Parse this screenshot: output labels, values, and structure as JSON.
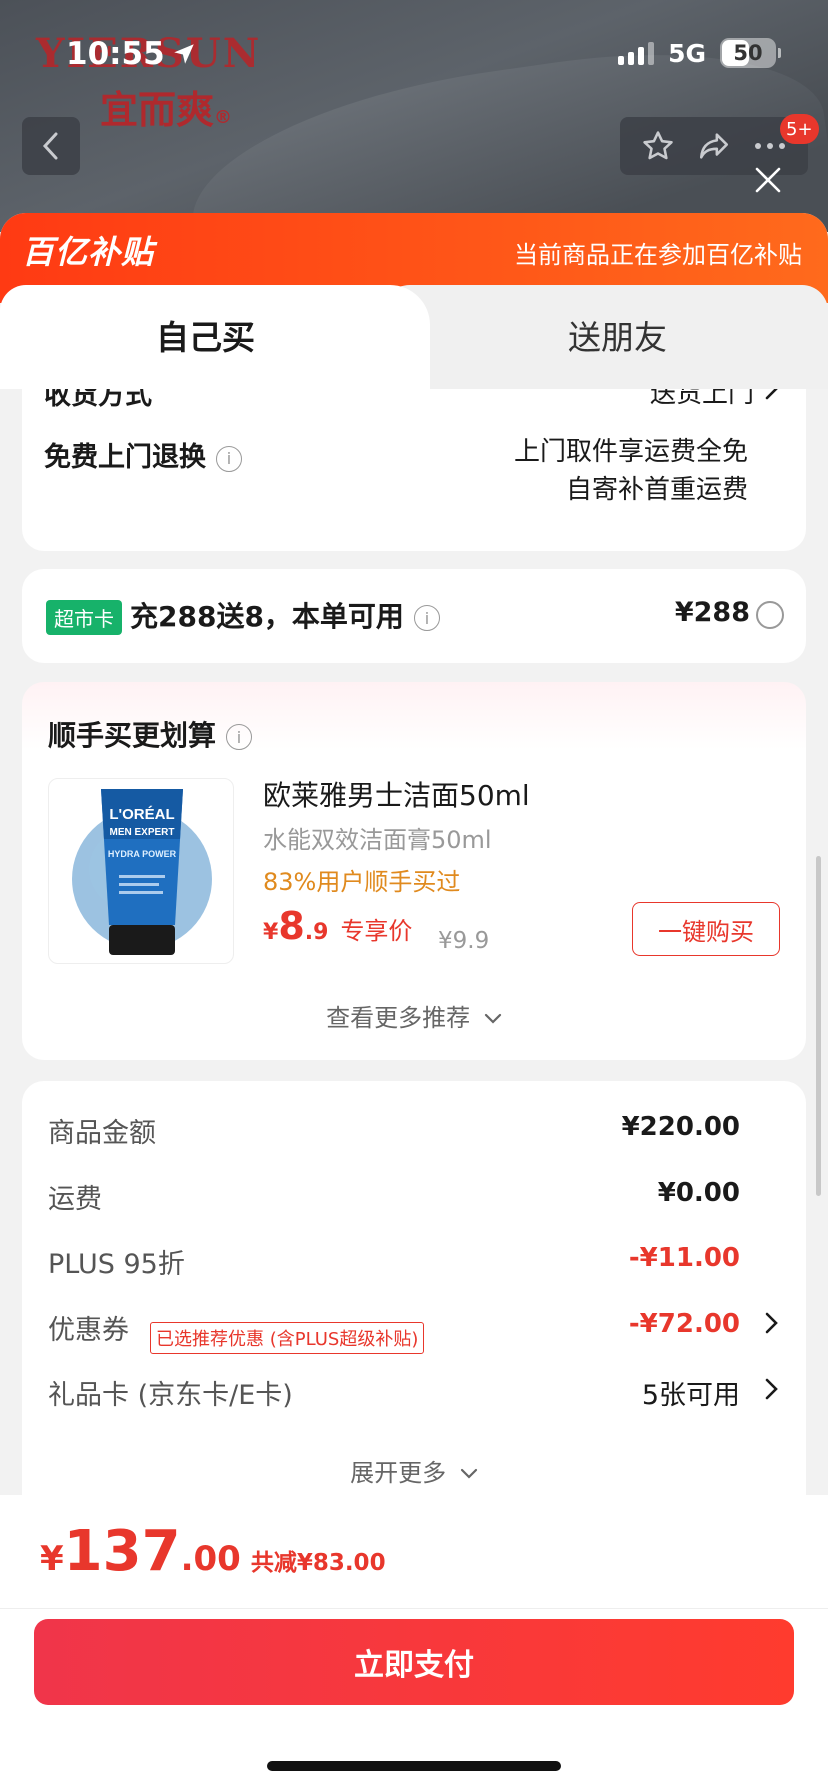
{
  "status_bar": {
    "time": "10:55",
    "network": "5G",
    "battery": "50",
    "battery_level": 0.5
  },
  "brand": {
    "name_latin": "YIERSUN",
    "name_cn": "宜而爽",
    "mark": "®"
  },
  "header": {
    "cart_badge": "5+"
  },
  "subsidy": {
    "logo_text": "百亿补贴",
    "note": "当前商品正在参加百亿补贴"
  },
  "tabs": [
    {
      "label": "自己买",
      "active": true
    },
    {
      "label": "送朋友",
      "active": false
    }
  ],
  "delivery": {
    "method_label": "收货方式",
    "method_value": "送货上门",
    "return_label": "免费上门退换",
    "return_value_line1": "上门取件享运费全免",
    "return_value_line2": "自寄补首重运费"
  },
  "supermarket_card": {
    "tag": "超市卡",
    "text": "充288送8，本单可用",
    "price": "¥288"
  },
  "recommendation": {
    "title": "顺手买更划算",
    "product": {
      "image_brand": "L'ORÉAL",
      "image_line": "MEN EXPERT",
      "image_sub": "HYDRA POWER",
      "name": "欧莱雅男士洁面50ml",
      "subtitle": "水能双效洁面膏50ml",
      "rate": "83%用户顺手买过",
      "price_currency": "¥",
      "price_int": "8",
      "price_dec": ".9",
      "price_label": "专享价",
      "orig_price": "¥9.9",
      "buy_label": "一键购买"
    },
    "more_label": "查看更多推荐"
  },
  "summary": {
    "rows": [
      {
        "label": "商品金额",
        "value": "¥220.00"
      },
      {
        "label": "运费",
        "value": "¥0.00"
      },
      {
        "label": "PLUS 95折",
        "value": "-¥11.00"
      },
      {
        "label": "优惠券",
        "tag": "已选推荐优惠 (含PLUS超级补贴)",
        "value": "-¥72.00"
      },
      {
        "label": "礼品卡 (京东卡/E卡)",
        "value": "5张可用"
      }
    ],
    "expand_label": "展开更多"
  },
  "footer": {
    "currency": "¥",
    "total_int": "137",
    "total_dec": ".00",
    "saved": "共减¥83.00",
    "pay_label": "立即支付"
  },
  "colors": {
    "accent": "#e8372c",
    "subsidy_orange": "#ff4a16",
    "tag_green": "#17b26a",
    "rate_orange": "#e08a1e"
  }
}
